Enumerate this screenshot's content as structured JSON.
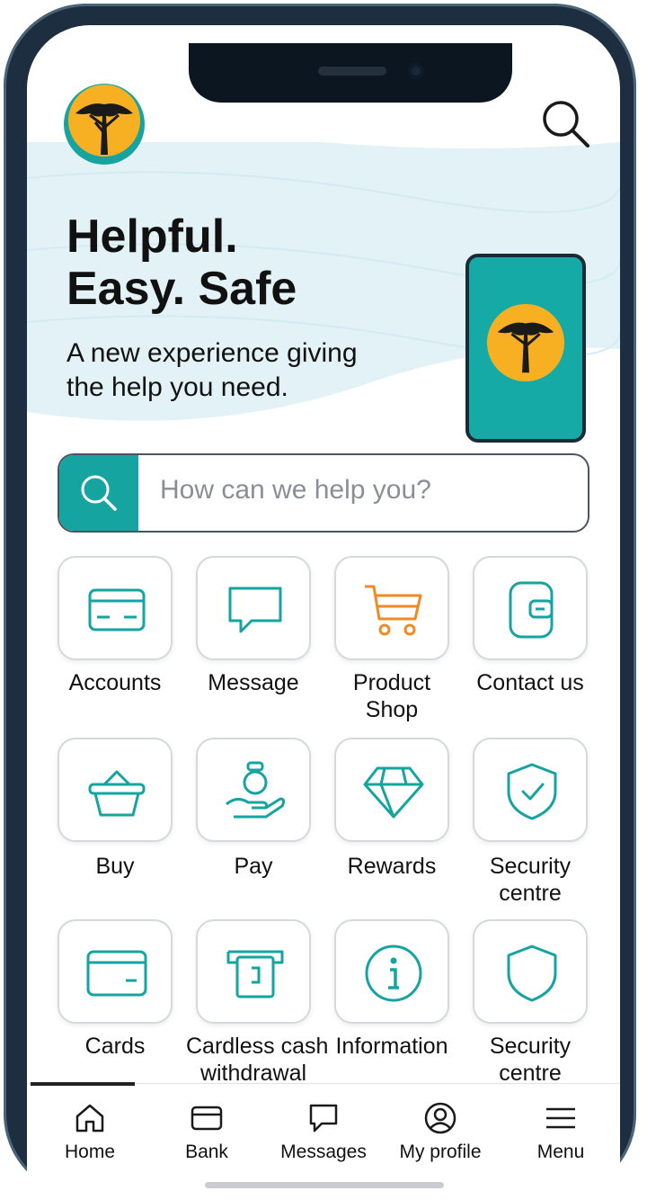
{
  "brand": {
    "logo": "fnb-tree-logo",
    "accent": "#15a4a0",
    "logo_sun": "#f6b022"
  },
  "header": {
    "search_icon": "search-icon"
  },
  "hero": {
    "headline_line1": "Helpful.",
    "headline_line2": "Easy. Safe",
    "subline_line1": "A new experience giving",
    "subline_line2": "the help you need."
  },
  "search": {
    "placeholder": "How can we help you?",
    "icon": "search-icon"
  },
  "grid": [
    {
      "label_line1": "Accounts",
      "label_line2": "",
      "icon": "wallet-icon"
    },
    {
      "label_line1": "Message",
      "label_line2": "",
      "icon": "chat-bubble-icon"
    },
    {
      "label_line1": "Product",
      "label_line2": "Shop",
      "icon": "shopping-cart-icon"
    },
    {
      "label_line1": "Contact us",
      "label_line2": "",
      "icon": "wallet-contact-icon"
    },
    {
      "label_line1": "Buy",
      "label_line2": "",
      "icon": "basket-icon"
    },
    {
      "label_line1": "Pay",
      "label_line2": "",
      "icon": "hand-coin-icon"
    },
    {
      "label_line1": "Rewards",
      "label_line2": "",
      "icon": "diamond-icon"
    },
    {
      "label_line1": "Security",
      "label_line2": "centre",
      "icon": "shield-check-icon"
    },
    {
      "label_line1": "Cards",
      "label_line2": "",
      "icon": "card-icon"
    },
    {
      "label_line1": "Cardless cash",
      "label_line2": "withdrawal",
      "icon": "atm-icon"
    },
    {
      "label_line1": "Information",
      "label_line2": "",
      "icon": "info-icon"
    },
    {
      "label_line1": "Security",
      "label_line2": "centre",
      "icon": "shield-icon"
    }
  ],
  "nav": [
    {
      "label": "Home",
      "icon": "home-icon"
    },
    {
      "label": "Bank",
      "icon": "bank-card-icon"
    },
    {
      "label": "Messages",
      "icon": "message-icon"
    },
    {
      "label": "My profile",
      "icon": "profile-icon"
    },
    {
      "label": "Menu",
      "icon": "menu-icon"
    }
  ]
}
